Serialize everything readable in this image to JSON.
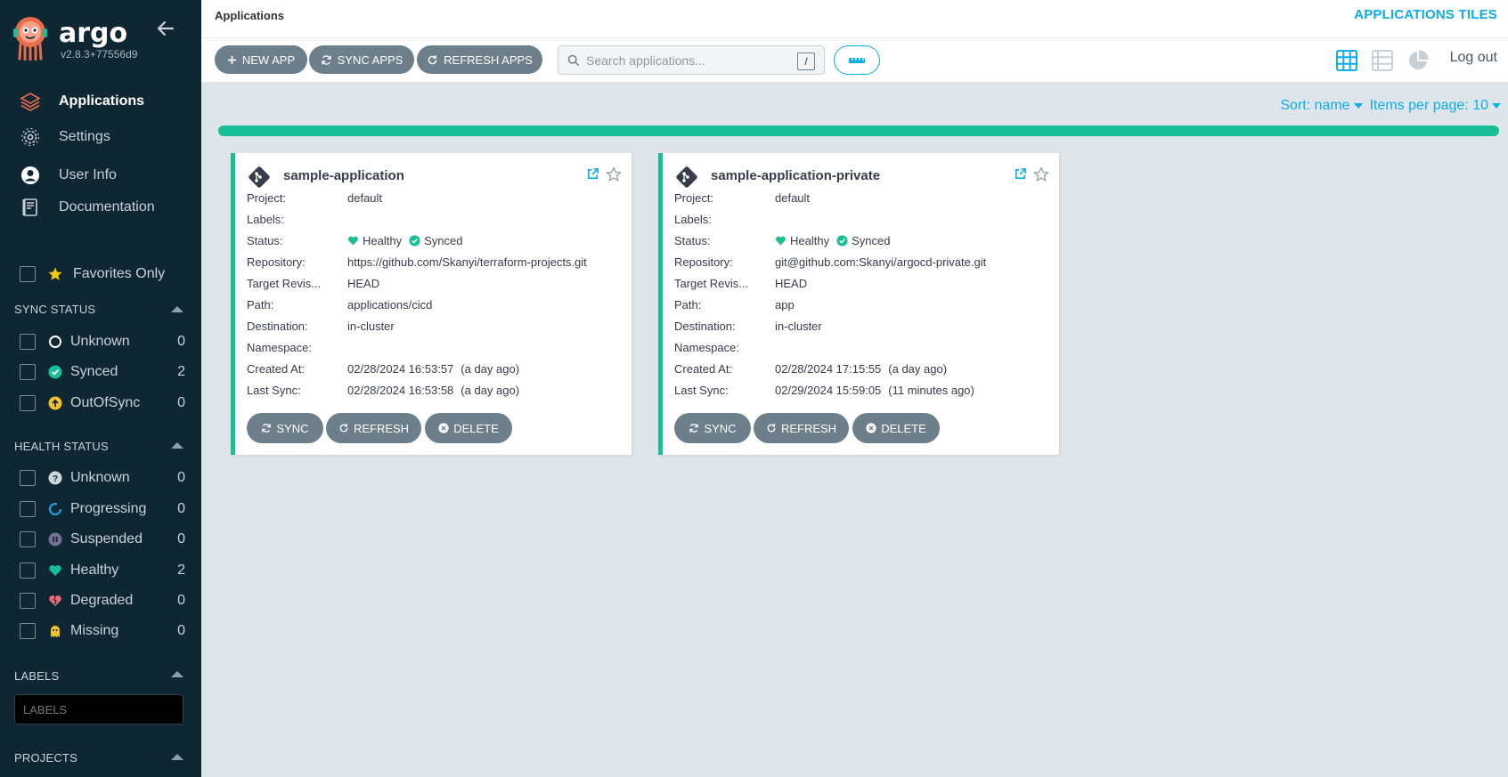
{
  "brand": {
    "name": "argo",
    "version": "v2.8.3+77556d9"
  },
  "nav": [
    {
      "label": "Applications",
      "icon": "layers-icon",
      "active": true
    },
    {
      "label": "Settings",
      "icon": "gears-icon",
      "active": false
    },
    {
      "label": "User Info",
      "icon": "user-circle-icon",
      "active": false
    },
    {
      "label": "Documentation",
      "icon": "book-icon",
      "active": false
    }
  ],
  "favorites_label": "Favorites Only",
  "sync_status": {
    "title": "SYNC STATUS",
    "items": [
      {
        "label": "Unknown",
        "count": "0",
        "icon": "circle-notch-icon"
      },
      {
        "label": "Synced",
        "count": "2",
        "icon": "check-circle-icon"
      },
      {
        "label": "OutOfSync",
        "count": "0",
        "icon": "arrow-up-circle-icon"
      }
    ]
  },
  "health_status": {
    "title": "HEALTH STATUS",
    "items": [
      {
        "label": "Unknown",
        "count": "0",
        "icon": "question-circle-icon"
      },
      {
        "label": "Progressing",
        "count": "0",
        "icon": "spinner-icon"
      },
      {
        "label": "Suspended",
        "count": "0",
        "icon": "pause-circle-icon"
      },
      {
        "label": "Healthy",
        "count": "2",
        "icon": "heart-icon"
      },
      {
        "label": "Degraded",
        "count": "0",
        "icon": "heart-broken-icon"
      },
      {
        "label": "Missing",
        "count": "0",
        "icon": "ghost-icon"
      }
    ]
  },
  "labels_section": {
    "title": "LABELS",
    "placeholder": "LABELS"
  },
  "projects_section": {
    "title": "PROJECTS"
  },
  "header": {
    "breadcrumb": "Applications",
    "view_title": "APPLICATIONS TILES"
  },
  "toolbar": {
    "new_app": "NEW APP",
    "sync_apps": "SYNC APPS",
    "refresh_apps": "REFRESH APPS",
    "search_placeholder": "Search applications...",
    "search_shortcut": "/",
    "logout": "Log out"
  },
  "sort": {
    "sort_label": "Sort: name",
    "per_page_label": "Items per page: 10"
  },
  "colors": {
    "accent": "#0dadea",
    "healthy": "#18be94",
    "sidebar": "#0f2733",
    "button": "#6d7f8b"
  },
  "row_labels": {
    "project": "Project:",
    "labels": "Labels:",
    "status": "Status:",
    "repository": "Repository:",
    "target": "Target Revis...",
    "path": "Path:",
    "destination": "Destination:",
    "namespace": "Namespace:",
    "created": "Created At:",
    "last_sync": "Last Sync:"
  },
  "card_buttons": {
    "sync": "SYNC",
    "refresh": "REFRESH",
    "delete": "DELETE"
  },
  "apps": [
    {
      "name": "sample-application",
      "project": "default",
      "labels": "",
      "health": "Healthy",
      "sync": "Synced",
      "repository": "https://github.com/Skanyi/terraform-projects.git",
      "target_revision": "HEAD",
      "path": "applications/cicd",
      "destination": "in-cluster",
      "namespace": "",
      "created_at": "02/28/2024 16:53:57",
      "created_ago": "(a day ago)",
      "last_sync": "02/28/2024 16:53:58",
      "last_sync_ago": "(a day ago)"
    },
    {
      "name": "sample-application-private",
      "project": "default",
      "labels": "",
      "health": "Healthy",
      "sync": "Synced",
      "repository": "git@github.com:Skanyi/argocd-private.git",
      "target_revision": "HEAD",
      "path": "app",
      "destination": "in-cluster",
      "namespace": "",
      "created_at": "02/28/2024 17:15:55",
      "created_ago": "(a day ago)",
      "last_sync": "02/29/2024 15:59:05",
      "last_sync_ago": "(11 minutes ago)"
    }
  ]
}
